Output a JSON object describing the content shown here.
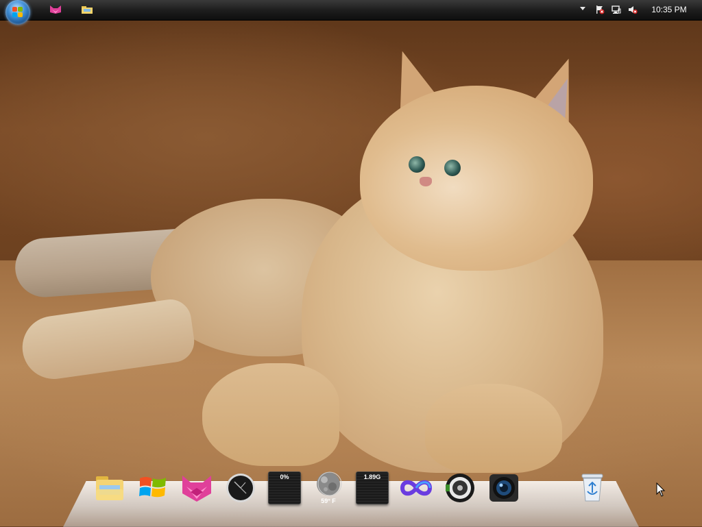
{
  "taskbar": {
    "start_button_icon": "windows-logo-icon",
    "pinned": [
      {
        "name": "cat-app",
        "icon": "pink-cat-icon"
      },
      {
        "name": "windows-explorer",
        "icon": "folder-icon"
      }
    ],
    "tray": {
      "icons": [
        "show-hidden-icons-chevron",
        "action-center-flag-icon",
        "network-icon",
        "volume-muted-icon"
      ],
      "clock": "10:35 PM"
    }
  },
  "desktop": {
    "wallpaper": "ginger cat lying on brown couch"
  },
  "dock": {
    "items": [
      {
        "name": "folder",
        "icon": "folder-icon"
      },
      {
        "name": "windows",
        "icon": "windows-flag-icon"
      },
      {
        "name": "cat-app",
        "icon": "pink-cat-icon"
      },
      {
        "name": "clock",
        "icon": "analog-clock-icon"
      },
      {
        "name": "cpu-meter",
        "icon": "cpu-meter-icon",
        "label": "0%"
      },
      {
        "name": "weather",
        "icon": "moon-weather-icon",
        "label": "59° F"
      },
      {
        "name": "memory-meter",
        "icon": "memory-meter-icon",
        "label": "1.89G"
      },
      {
        "name": "infinity-app",
        "icon": "infinity-icon"
      },
      {
        "name": "speaker",
        "icon": "speaker-icon"
      },
      {
        "name": "camera",
        "icon": "camera-lens-icon"
      },
      {
        "name": "recycle-bin",
        "icon": "recycle-bin-icon"
      }
    ]
  },
  "colors": {
    "taskbar": "#1e1e1e",
    "tray_text": "#ffffff",
    "pink_accent": "#e0409a",
    "infinity_purple": "#6a3ce0"
  }
}
